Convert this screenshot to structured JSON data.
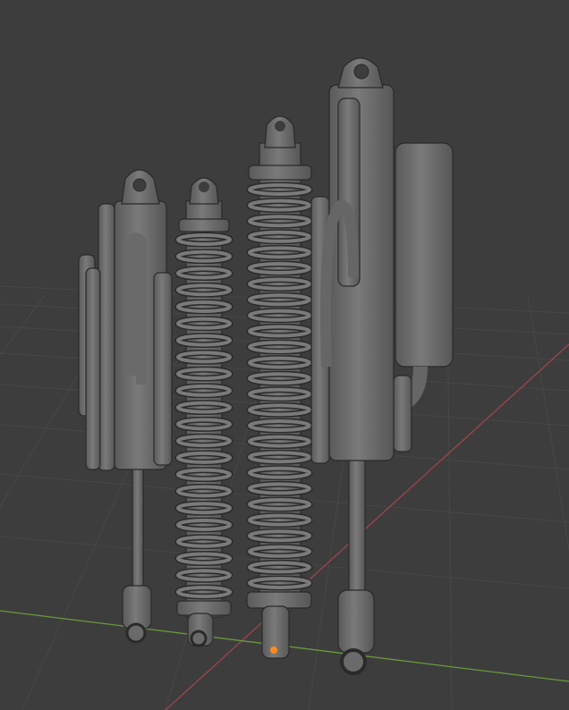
{
  "scene": {
    "background_color": "#3d3d3d",
    "grid_color": "#474747",
    "x_axis_color": "#a0444c",
    "y_axis_color": "#6a9a3a",
    "metal_color": "#6e6e6e",
    "selection_color": "#ff8a1e"
  },
  "objects": [
    {
      "name": "reservoir-shock-small",
      "coils": 0
    },
    {
      "name": "coilover-small",
      "coils": 22
    },
    {
      "name": "coilover-large",
      "coils": 26
    },
    {
      "name": "reservoir-shock-large",
      "coils": 0
    }
  ]
}
